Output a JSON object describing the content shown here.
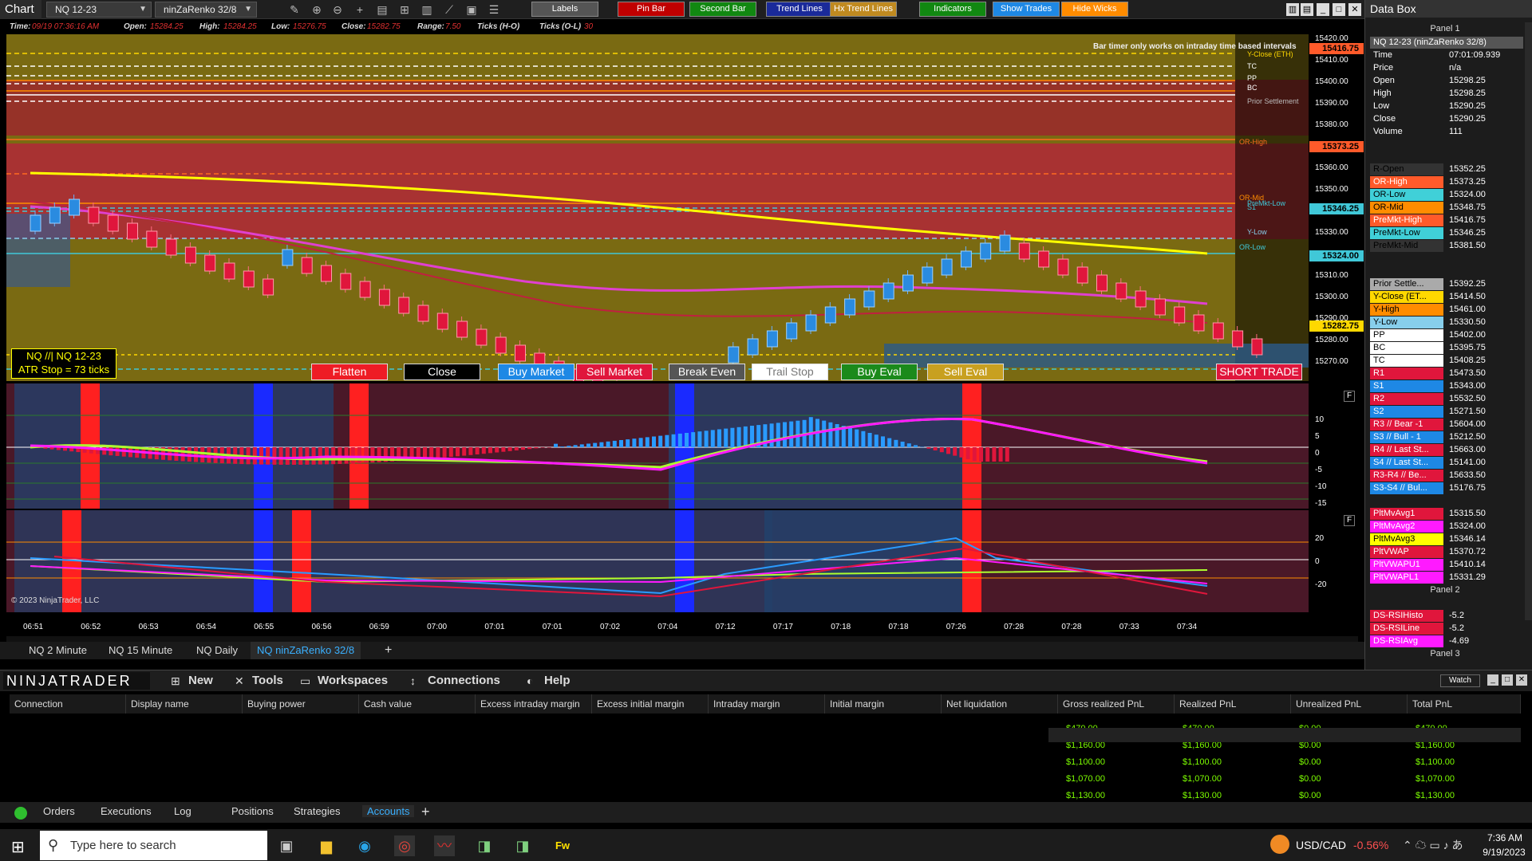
{
  "toolbar": {
    "title": "Chart",
    "instrument": "NQ 12-23",
    "bar_type": "ninZaRenko 32/8",
    "buttons": [
      {
        "label": "Labels",
        "color": "#555555"
      },
      {
        "label": "Pin Bar",
        "color": "#c00000"
      },
      {
        "label": "Second Bar",
        "color": "#118811"
      },
      {
        "label": "Trend Lines",
        "color": "#1a2a9a"
      },
      {
        "label": "Hx Trend Lines",
        "color": "#c08a20"
      },
      {
        "label": "Indicators",
        "color": "#118811"
      },
      {
        "label": "Show Trades",
        "color": "#1e88e5"
      },
      {
        "label": "Hide Wicks",
        "color": "#ff8c00"
      }
    ]
  },
  "info": {
    "time_label": "Time:",
    "time": "09/19 07:36:16 AM",
    "open_label": "Open:",
    "open": "15284.25",
    "high_label": "High:",
    "high": "15284.25",
    "low_label": "Low:",
    "low": "15276.75",
    "close_label": "Close:",
    "close": "15282.75",
    "range_label": "Range:",
    "range": "7.50",
    "ticks_hl_label": "Ticks (H-O)",
    "ticks_ol_label": "Ticks (O-L)",
    "ticks_ol": "30"
  },
  "chart": {
    "bar_timer_msg": "Bar timer only works on intraday time based intervals",
    "atr_line1": "NQ //| NQ 12-23",
    "atr_line2": "ATR Stop = 73 ticks",
    "copyright": "© 2023 NinjaTrader, LLC",
    "level_labels": [
      "Y-Close (ETH)",
      "TC",
      "PP",
      "BC",
      "Prior Settlement",
      "OR-High",
      "OR-Mid",
      "PreMkt-Low",
      "S1",
      "Y-Low",
      "OR-Low"
    ],
    "price_ticks": [
      "15420.00",
      "15410.00",
      "15400.00",
      "15390.00",
      "15380.00",
      "15370.00",
      "15360.00",
      "15350.00",
      "15340.00",
      "15330.00",
      "15320.00",
      "15310.00",
      "15300.00",
      "15290.00",
      "15280.00",
      "15270.00"
    ],
    "price_badges": [
      {
        "value": "15416.75",
        "color": "#ff5a2a"
      },
      {
        "value": "15373.25",
        "color": "#ff5a2a"
      },
      {
        "value": "15346.25",
        "color": "#40c8d8"
      },
      {
        "value": "15324.00",
        "color": "#40c8d8"
      },
      {
        "value": "15282.75",
        "color": "#ffd800"
      }
    ],
    "panel2_ticks": [
      "10",
      "5",
      "0",
      "-5",
      "-10",
      "-15"
    ],
    "panel2_flag": "F",
    "panel3_ticks": [
      "20",
      "0",
      "-20"
    ],
    "panel3_flag": "F",
    "time_ticks": [
      "06:51",
      "06:52",
      "06:53",
      "06:54",
      "06:55",
      "06:56",
      "06:59",
      "07:00",
      "07:01",
      "07:01",
      "07:02",
      "07:04",
      "07:12",
      "07:17",
      "07:18",
      "07:18",
      "07:26",
      "07:28",
      "07:28",
      "07:33",
      "07:34"
    ],
    "trade_buttons": [
      {
        "label": "Flatten",
        "color": "#ee1c25"
      },
      {
        "label": "Close",
        "color": "#000000"
      },
      {
        "label": "Buy Market",
        "color": "#1e88e5"
      },
      {
        "label": "Sell Market",
        "color": "#e0163c"
      },
      {
        "label": "Break Even",
        "color": "#555555"
      },
      {
        "label": "Trail Stop",
        "color": "#ffffff"
      },
      {
        "label": "Buy Eval",
        "color": "#1b8a1b"
      },
      {
        "label": "Sell Eval",
        "color": "#c8a020"
      },
      {
        "label": "SHORT TRADE",
        "color": "#e0163c"
      }
    ],
    "candles_dir": [
      1,
      1,
      1,
      0,
      0,
      0,
      0,
      0,
      0,
      0,
      0,
      0,
      0,
      1,
      0,
      0,
      0,
      0,
      0,
      0,
      0,
      0,
      0,
      0,
      0,
      0,
      0,
      0,
      0,
      0,
      0,
      0,
      0,
      0,
      0,
      0,
      1,
      1,
      1,
      1,
      1,
      1,
      1,
      1,
      1,
      1,
      1,
      1,
      1,
      1,
      1,
      0,
      0,
      0,
      0,
      0,
      0,
      0,
      0,
      0,
      0,
      0,
      0,
      0
    ],
    "tabs": [
      "NQ  2 Minute",
      "NQ  15 Minute",
      "NQ  Daily",
      "NQ  ninZaRenko 32/8"
    ]
  },
  "databox": {
    "title": "Data Box",
    "panel1": "Panel 1",
    "panel2": "Panel 2",
    "panel3": "Panel 3",
    "header": "NQ 12-23 (ninZaRenko 32/8)",
    "main": [
      {
        "k": "Time",
        "v": "07:01:09.939"
      },
      {
        "k": "Price",
        "v": "n/a"
      },
      {
        "k": "Open",
        "v": "15298.25"
      },
      {
        "k": "High",
        "v": "15298.25"
      },
      {
        "k": "Low",
        "v": "15290.25"
      },
      {
        "k": "Close",
        "v": "15290.25"
      },
      {
        "k": "Volume",
        "v": "111"
      }
    ],
    "levels": [
      {
        "k": "R-Open",
        "v": "15352.25",
        "bg": "#333333",
        "fg": "#000000"
      },
      {
        "k": "OR-High",
        "v": "15373.25",
        "bg": "#ff5a2a",
        "fg": "#ffffff"
      },
      {
        "k": "OR-Low",
        "v": "15324.00",
        "bg": "#40d0d8",
        "fg": "#000000"
      },
      {
        "k": "OR-Mid",
        "v": "15348.75",
        "bg": "#ff8c00",
        "fg": "#000000"
      },
      {
        "k": "PreMkt-High",
        "v": "15416.75",
        "bg": "#ff5a2a",
        "fg": "#ffffff"
      },
      {
        "k": "PreMkt-Low",
        "v": "15346.25",
        "bg": "#40d0d8",
        "fg": "#000000"
      },
      {
        "k": "PreMkt-Mid",
        "v": "15381.50",
        "bg": "#333333",
        "fg": "#000000"
      }
    ],
    "pivots": [
      {
        "k": "Prior Settle...",
        "v": "15392.25",
        "bg": "#aaaaaa",
        "fg": "#000000"
      },
      {
        "k": "Y-Close (ET...",
        "v": "15414.50",
        "bg": "#ffd800",
        "fg": "#000000"
      },
      {
        "k": "Y-High",
        "v": "15461.00",
        "bg": "#ff8c00",
        "fg": "#000000"
      },
      {
        "k": "Y-Low",
        "v": "15330.50",
        "bg": "#87ceeb",
        "fg": "#000000"
      },
      {
        "k": "PP",
        "v": "15402.00",
        "bg": "#ffffff",
        "fg": "#000000"
      },
      {
        "k": "BC",
        "v": "15395.75",
        "bg": "#ffffff",
        "fg": "#000000"
      },
      {
        "k": "TC",
        "v": "15408.25",
        "bg": "#ffffff",
        "fg": "#000000"
      },
      {
        "k": "R1",
        "v": "15473.50",
        "bg": "#e0163c",
        "fg": "#ffffff"
      },
      {
        "k": "S1",
        "v": "15343.00",
        "bg": "#1e88e5",
        "fg": "#ffffff"
      },
      {
        "k": "R2",
        "v": "15532.50",
        "bg": "#e0163c",
        "fg": "#ffffff"
      },
      {
        "k": "S2",
        "v": "15271.50",
        "bg": "#1e88e5",
        "fg": "#ffffff"
      },
      {
        "k": "R3 // Bear -1",
        "v": "15604.00",
        "bg": "#e0163c",
        "fg": "#ffffff"
      },
      {
        "k": "S3 // Bull - 1",
        "v": "15212.50",
        "bg": "#1e88e5",
        "fg": "#ffffff"
      },
      {
        "k": "R4 // Last St...",
        "v": "15663.00",
        "bg": "#e0163c",
        "fg": "#ffffff"
      },
      {
        "k": "S4 // Last St...",
        "v": "15141.00",
        "bg": "#1e88e5",
        "fg": "#ffffff"
      },
      {
        "k": "R3-R4 // Be...",
        "v": "15633.50",
        "bg": "#e0163c",
        "fg": "#ffffff"
      },
      {
        "k": "S3-S4 // Bul...",
        "v": "15176.75",
        "bg": "#1e88e5",
        "fg": "#ffffff"
      }
    ],
    "mas": [
      {
        "k": "PltMvAvg1",
        "v": "15315.50",
        "bg": "#e0163c",
        "fg": "#ffffff"
      },
      {
        "k": "PltMvAvg2",
        "v": "15324.00",
        "bg": "#ff1aff",
        "fg": "#ffffff"
      },
      {
        "k": "PltMvAvg3",
        "v": "15346.14",
        "bg": "#ffff00",
        "fg": "#000000"
      },
      {
        "k": "PltVWAP",
        "v": "15370.72",
        "bg": "#e0163c",
        "fg": "#ffffff"
      },
      {
        "k": "PltVWAPU1",
        "v": "15410.14",
        "bg": "#ff1aff",
        "fg": "#ffffff"
      },
      {
        "k": "PltVWAPL1",
        "v": "15331.29",
        "bg": "#ff1aff",
        "fg": "#ffffff"
      }
    ],
    "rsi": [
      {
        "k": "DS-RSIHisto",
        "v": "-5.2",
        "bg": "#e0163c",
        "fg": "#ffffff"
      },
      {
        "k": "DS-RSILine",
        "v": "-5.2",
        "bg": "#e0163c",
        "fg": "#ffffff"
      },
      {
        "k": "DS-RSIAvg",
        "v": "-4.69",
        "bg": "#ff1aff",
        "fg": "#ffffff"
      }
    ]
  },
  "control": {
    "brand": "NINJATRADER",
    "menu": [
      "New",
      "Tools",
      "Workspaces",
      "Connections",
      "Help"
    ],
    "watch": "Watch"
  },
  "accounts": {
    "columns": [
      "Connection",
      "Display name",
      "Buying power",
      "Cash value",
      "Excess intraday margin",
      "Excess initial margin",
      "Intraday margin",
      "Initial margin",
      "Net liquidation",
      "Gross realized PnL",
      "Realized PnL",
      "Unrealized PnL",
      "Total PnL"
    ],
    "rows": [
      [
        "$470.00",
        "$470.00",
        "$0.00",
        "$470.00"
      ],
      [
        "$1,160.00",
        "$1,160.00",
        "$0.00",
        "$1,160.00"
      ],
      [
        "$1,100.00",
        "$1,100.00",
        "$0.00",
        "$1,100.00"
      ],
      [
        "$1,070.00",
        "$1,070.00",
        "$0.00",
        "$1,070.00"
      ],
      [
        "$1,130.00",
        "$1,130.00",
        "$0.00",
        "$1,130.00"
      ]
    ]
  },
  "bottom_tabs": [
    "Orders",
    "Executions",
    "Log",
    "Positions",
    "Strategies",
    "Accounts"
  ],
  "taskbar": {
    "search_placeholder": "Type here to search",
    "ticker": "USD/CAD",
    "change": "-0.56%",
    "time": "7:36 AM",
    "date": "9/19/2023"
  }
}
